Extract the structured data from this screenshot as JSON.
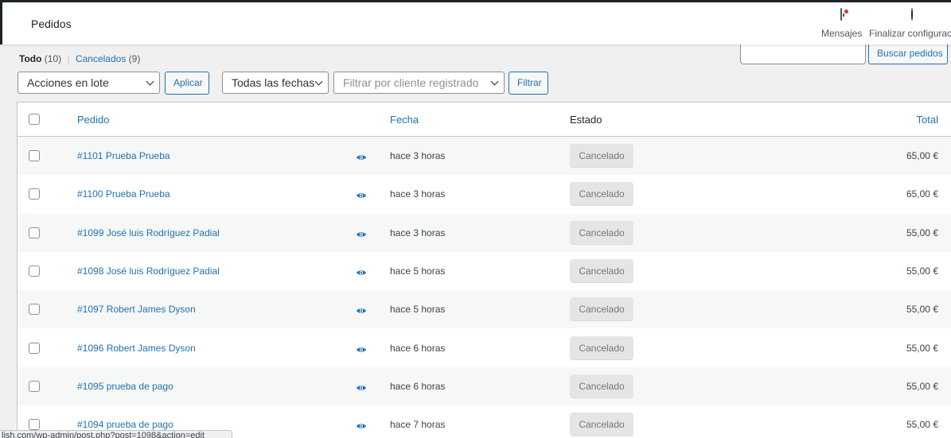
{
  "header": {
    "title": "Pedidos",
    "messages_label": "Mensajes",
    "finish_label": "Finalizar configuraci"
  },
  "views": {
    "all_label": "Todo",
    "all_count": "(10)",
    "cancelled_label": "Cancelados",
    "cancelled_count": "(9)"
  },
  "search": {
    "value": "",
    "button_label": "Buscar pedidos"
  },
  "filters": {
    "bulk_actions": "Acciones en lote",
    "apply_label": "Aplicar",
    "dates": "Todas las fechas",
    "customer_placeholder": "Filtrar por cliente registrado",
    "filter_label": "Filtrar"
  },
  "table": {
    "columns": {
      "order": "Pedido",
      "date": "Fecha",
      "status": "Estado",
      "total": "Total"
    },
    "rows": [
      {
        "order": "#1101 Prueba Prueba",
        "date": "hace 3 horas",
        "status": "Cancelado",
        "total": "65,00 €"
      },
      {
        "order": "#1100 Prueba Prueba",
        "date": "hace 3 horas",
        "status": "Cancelado",
        "total": "65,00 €"
      },
      {
        "order": "#1099 José luis Rodríguez Padial",
        "date": "hace 3 horas",
        "status": "Cancelado",
        "total": "55,00 €"
      },
      {
        "order": "#1098 José luis Rodríguez Padial",
        "date": "hace 5 horas",
        "status": "Cancelado",
        "total": "55,00 €"
      },
      {
        "order": "#1097 Robert James Dyson",
        "date": "hace 5 horas",
        "status": "Cancelado",
        "total": "55,00 €"
      },
      {
        "order": "#1096 Robert James Dyson",
        "date": "hace 6 horas",
        "status": "Cancelado",
        "total": "55,00 €"
      },
      {
        "order": "#1095 prueba de pago",
        "date": "hace 6 horas",
        "status": "Cancelado",
        "total": "55,00 €"
      },
      {
        "order": "#1094 prueba de pago",
        "date": "hace 7 horas",
        "status": "Cancelado",
        "total": "55,00 €"
      }
    ]
  },
  "statusbar": {
    "url": "lish.com/wp-admin/post.php?post=1098&action=edit"
  },
  "colors": {
    "link": "#2271b1",
    "status_cancelled_bg": "#e5e5e5",
    "notification_dot": "#d63638"
  }
}
